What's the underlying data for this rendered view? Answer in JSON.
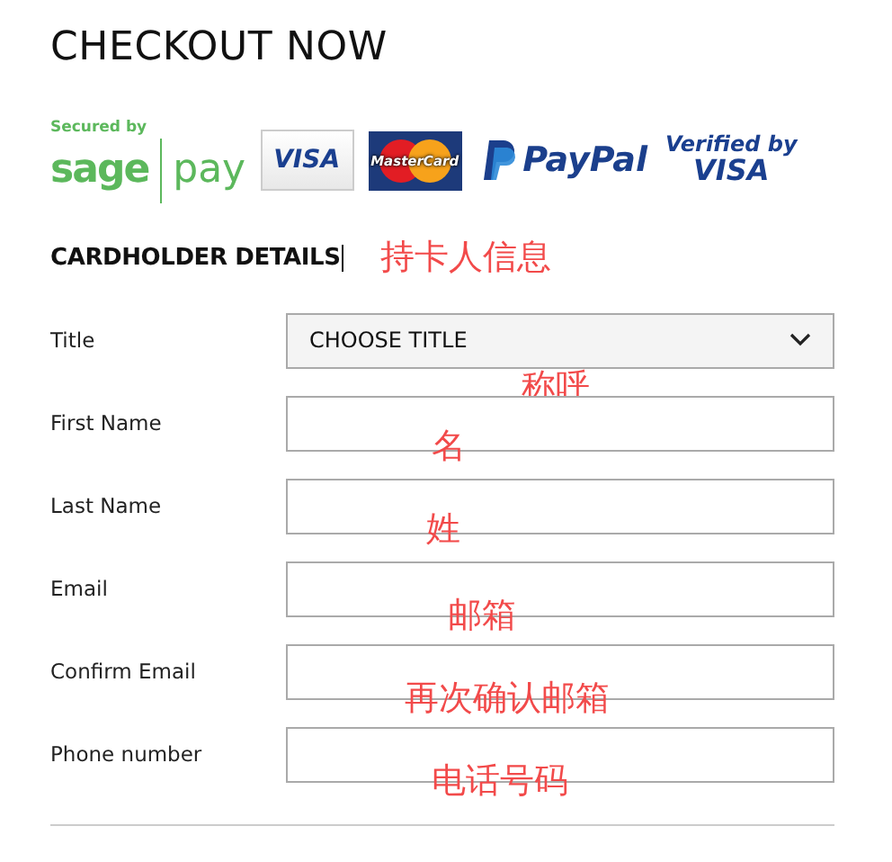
{
  "heading": "CHECKOUT NOW",
  "payment_logos": {
    "secured_by": "Secured by",
    "sage": "sage",
    "pay": "pay",
    "visa": "VISA",
    "mastercard": "MasterCard",
    "paypal": "PayPal",
    "verified_by": "Verified by",
    "verified_visa": "VISA"
  },
  "section": {
    "title": "CARDHOLDER DETAILS",
    "annotation": "持卡人信息"
  },
  "fields": [
    {
      "kind": "select",
      "label": "Title",
      "value": "CHOOSE TITLE",
      "annotation": "称呼"
    },
    {
      "kind": "text",
      "label": "First Name",
      "annotation": "名"
    },
    {
      "kind": "text",
      "label": "Last Name",
      "annotation": "姓"
    },
    {
      "kind": "text",
      "label": "Email",
      "annotation": "邮箱"
    },
    {
      "kind": "text",
      "label": "Confirm Email",
      "annotation": "再次确认邮箱"
    },
    {
      "kind": "text",
      "label": "Phone number",
      "annotation": "电话号码"
    }
  ]
}
